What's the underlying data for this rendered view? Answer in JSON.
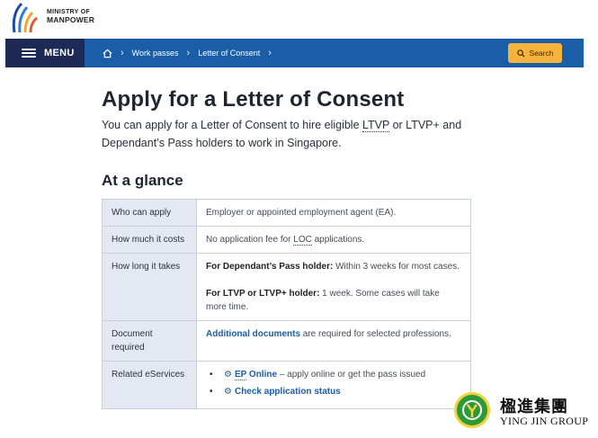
{
  "logo": {
    "line1": "MINISTRY OF",
    "line2": "MANPOWER"
  },
  "nav": {
    "menu_label": "MENU",
    "breadcrumbs": [
      "Work passes",
      "Letter of Consent"
    ],
    "search_label": "Search"
  },
  "page": {
    "title": "Apply for a Letter of Consent",
    "intro_a": "You can apply for a Letter of Consent to hire eligible ",
    "intro_abbr": "LTVP",
    "intro_b": " or LTVP+ and Dependant’s Pass holders to work in Singapore.",
    "section_title": "At a glance"
  },
  "table": {
    "rows": [
      {
        "key": "Who can apply",
        "value": "Employer or appointed employment agent (EA)."
      },
      {
        "key": "How much it costs",
        "value_a": "No application fee for ",
        "value_abbr": "LOC",
        "value_b": " applications."
      },
      {
        "key": "How long it takes",
        "p1_bold": "For Dependant’s Pass holder:",
        "p1_rest": " Within 3 weeks for most cases.",
        "p2_bold": "For LTVP or LTVP+ holder:",
        "p2_rest": " 1 week. Some cases will take more time."
      },
      {
        "key": "Document required",
        "link": "Additional documents",
        "rest": " are required for selected professions."
      },
      {
        "key": "Related eServices",
        "item1_link_abbr": "EP",
        "item1_link_rest": " Online",
        "item1_rest": " – apply online or get the pass issued",
        "item2_link": "Check application status"
      }
    ]
  },
  "watermark": {
    "cn": "楹進集團",
    "en": "YING JIN GROUP"
  },
  "colors": {
    "nav": "#1a5ea8",
    "menu": "#1d2a55",
    "search": "#f7b23b",
    "table_key_bg": "#e3e8f2"
  }
}
